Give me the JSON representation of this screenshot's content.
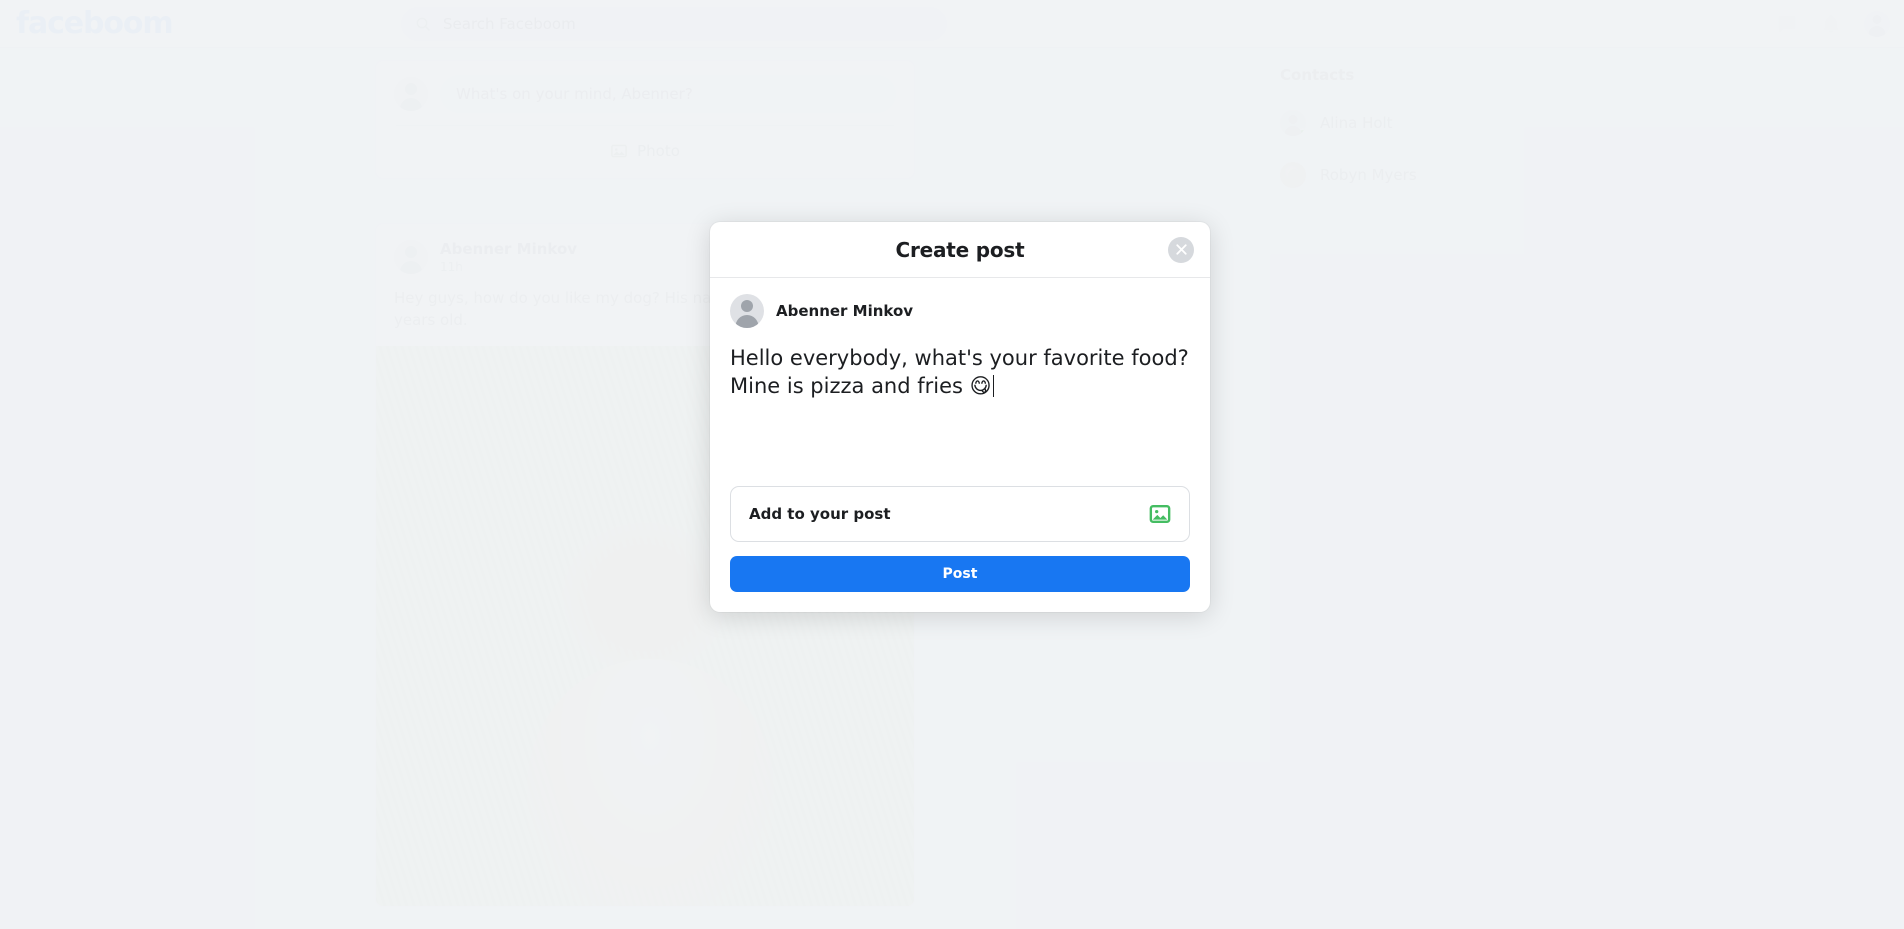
{
  "header": {
    "brand": "faceboom",
    "search": {
      "placeholder": "Search Faceboom",
      "value": "",
      "icon": "search-icon"
    },
    "icons": [
      "messenger-icon",
      "notifications-bell-icon"
    ],
    "avatar_alt": "profile-avatar"
  },
  "composer": {
    "placeholder": "What's on your mind, Abenner?",
    "value": "",
    "photo_label": "Photo"
  },
  "feed": {
    "posts": [
      {
        "author": "Abenner Minkov",
        "time": "11h",
        "text": "Hey guys, how do you like my dog? His name is Rex and he is 3 years old.",
        "has_photo": true,
        "photo_alt": "golden dog lying in grass"
      }
    ]
  },
  "rail": {
    "title": "Contacts",
    "contacts": [
      {
        "name": "Alina Holt",
        "online": true,
        "avatar": "silhouette"
      },
      {
        "name": "Robyn Myers",
        "online": false,
        "avatar": "photo"
      }
    ]
  },
  "modal": {
    "title": "Create post",
    "close_label": "×",
    "author": "Abenner Minkov",
    "post_text": "Hello everybody, what's your favorite food? Mine is pizza and fries 😋",
    "add_to_post_label": "Add to your post",
    "photo_icon": "photo-image-icon",
    "submit_label": "Post"
  },
  "colors": {
    "accent_blue": "#1877f2",
    "brand_blue": "#b9d2f2",
    "photo_green": "#45bd62",
    "online_green": "#31a24c",
    "page_bg": "#eef0f2",
    "card_bg": "#ffffff"
  }
}
